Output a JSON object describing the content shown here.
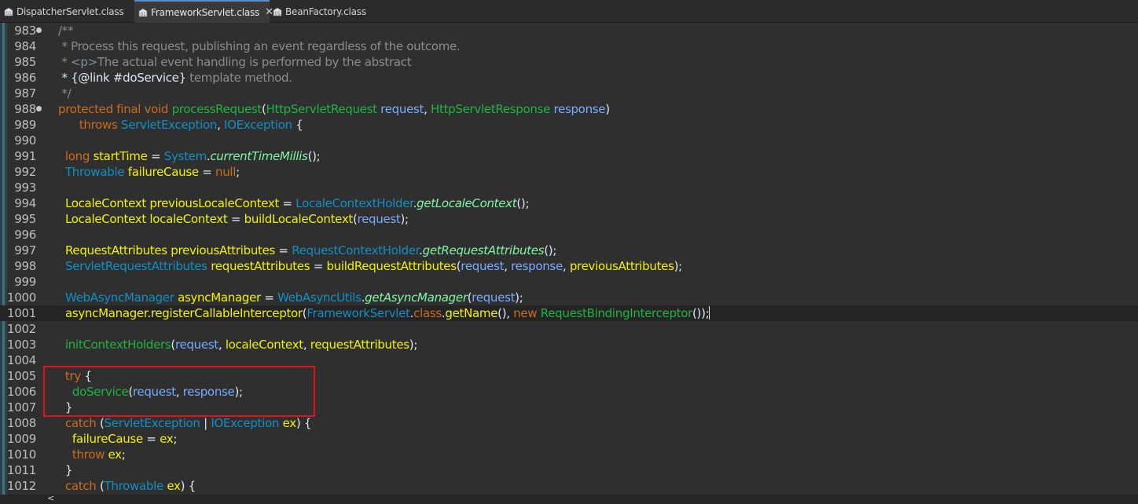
{
  "tabs": [
    {
      "label": "DispatcherServlet.class",
      "active": false,
      "closable": false,
      "icon": "class-file-icon"
    },
    {
      "label": "FrameworkServlet.class",
      "active": true,
      "closable": true,
      "icon": "class-file-icon"
    },
    {
      "label": "BeanFactory.class",
      "active": false,
      "closable": false,
      "icon": "class-file-icon"
    }
  ],
  "close_glyph": "✕",
  "scroll_left_glyph": "<",
  "colors": {
    "background": "#2f2f2f",
    "keyword": "#cc6c1d",
    "type": "#1290c3",
    "method": "#1eb540",
    "static_method": "#80f6a7",
    "parameter": "#79abff",
    "local_variable": "#f2f200",
    "comment": "#8c8c8c",
    "highlight_box": "#e0141e"
  },
  "lines": [
    {
      "n": "983",
      "fold": true,
      "t": [
        {
          "s": "/**",
          "k": "c"
        }
      ]
    },
    {
      "n": "984",
      "t": [
        {
          "s": " * Process this request, publishing an event regardless of the outcome.",
          "k": "c"
        }
      ]
    },
    {
      "n": "985",
      "t": [
        {
          "s": " * ",
          "k": "c"
        },
        {
          "s": "<p>",
          "k": "ct"
        },
        {
          "s": "The actual event handling is performed by the abstract",
          "k": "c"
        }
      ]
    },
    {
      "n": "986",
      "t": [
        {
          "s": " * {@link #doService}",
          "k": "tx"
        },
        {
          "s": " template method.",
          "k": "c"
        }
      ]
    },
    {
      "n": "987",
      "t": [
        {
          "s": " */",
          "k": "c"
        }
      ]
    },
    {
      "n": "988",
      "fold": true,
      "t": [
        {
          "s": "protected final void ",
          "k": "kw"
        },
        {
          "s": "processRequest",
          "k": "fn"
        },
        {
          "s": "(",
          "k": "tx"
        },
        {
          "s": "HttpServletRequest",
          "k": "fn"
        },
        {
          "s": " ",
          "k": "tx"
        },
        {
          "s": "request",
          "k": "pa"
        },
        {
          "s": ", ",
          "k": "tx"
        },
        {
          "s": "HttpServletResponse",
          "k": "fn"
        },
        {
          "s": " ",
          "k": "tx"
        },
        {
          "s": "response",
          "k": "pa"
        },
        {
          "s": ")",
          "k": "tx"
        }
      ]
    },
    {
      "n": "989",
      "t": [
        {
          "s": "      throws ",
          "k": "kw"
        },
        {
          "s": "ServletException",
          "k": "ty"
        },
        {
          "s": ", ",
          "k": "tx"
        },
        {
          "s": "IOException",
          "k": "ty"
        },
        {
          "s": " {",
          "k": "tx"
        }
      ]
    },
    {
      "n": "990",
      "t": []
    },
    {
      "n": "991",
      "t": [
        {
          "s": "  long ",
          "k": "kw"
        },
        {
          "s": "startTime",
          "k": "lv"
        },
        {
          "s": " = ",
          "k": "tx"
        },
        {
          "s": "System",
          "k": "ty"
        },
        {
          "s": ".",
          "k": "tx"
        },
        {
          "s": "currentTimeMillis",
          "k": "sm"
        },
        {
          "s": "();",
          "k": "tx"
        }
      ]
    },
    {
      "n": "992",
      "t": [
        {
          "s": "  ",
          "k": "tx"
        },
        {
          "s": "Throwable",
          "k": "ty"
        },
        {
          "s": " ",
          "k": "tx"
        },
        {
          "s": "failureCause",
          "k": "lv"
        },
        {
          "s": " = ",
          "k": "tx"
        },
        {
          "s": "null",
          "k": "kw"
        },
        {
          "s": ";",
          "k": "tx"
        }
      ]
    },
    {
      "n": "993",
      "t": []
    },
    {
      "n": "994",
      "t": [
        {
          "s": "  ",
          "k": "tx"
        },
        {
          "s": "LocaleContext",
          "k": "lv"
        },
        {
          "s": " ",
          "k": "tx"
        },
        {
          "s": "previousLocaleContext",
          "k": "lv"
        },
        {
          "s": " = ",
          "k": "tx"
        },
        {
          "s": "LocaleContextHolder",
          "k": "ty"
        },
        {
          "s": ".",
          "k": "tx"
        },
        {
          "s": "getLocaleContext",
          "k": "sm"
        },
        {
          "s": "();",
          "k": "tx"
        }
      ]
    },
    {
      "n": "995",
      "t": [
        {
          "s": "  ",
          "k": "tx"
        },
        {
          "s": "LocaleContext",
          "k": "lv"
        },
        {
          "s": " ",
          "k": "tx"
        },
        {
          "s": "localeContext",
          "k": "lv"
        },
        {
          "s": " = ",
          "k": "tx"
        },
        {
          "s": "buildLocaleContext",
          "k": "lv"
        },
        {
          "s": "(",
          "k": "tx"
        },
        {
          "s": "request",
          "k": "pa"
        },
        {
          "s": ");",
          "k": "tx"
        }
      ]
    },
    {
      "n": "996",
      "t": []
    },
    {
      "n": "997",
      "t": [
        {
          "s": "  ",
          "k": "tx"
        },
        {
          "s": "RequestAttributes",
          "k": "lv"
        },
        {
          "s": " ",
          "k": "tx"
        },
        {
          "s": "previousAttributes",
          "k": "lv"
        },
        {
          "s": " = ",
          "k": "tx"
        },
        {
          "s": "RequestContextHolder",
          "k": "ty"
        },
        {
          "s": ".",
          "k": "tx"
        },
        {
          "s": "getRequestAttributes",
          "k": "sm"
        },
        {
          "s": "();",
          "k": "tx"
        }
      ]
    },
    {
      "n": "998",
      "t": [
        {
          "s": "  ",
          "k": "tx"
        },
        {
          "s": "ServletRequestAttributes",
          "k": "ty"
        },
        {
          "s": " ",
          "k": "tx"
        },
        {
          "s": "requestAttributes",
          "k": "lv"
        },
        {
          "s": " = ",
          "k": "tx"
        },
        {
          "s": "buildRequestAttributes",
          "k": "lv"
        },
        {
          "s": "(",
          "k": "tx"
        },
        {
          "s": "request",
          "k": "pa"
        },
        {
          "s": ", ",
          "k": "tx"
        },
        {
          "s": "response",
          "k": "pa"
        },
        {
          "s": ", ",
          "k": "tx"
        },
        {
          "s": "previousAttributes",
          "k": "lv"
        },
        {
          "s": ");",
          "k": "tx"
        }
      ]
    },
    {
      "n": "999",
      "t": []
    },
    {
      "n": "1000",
      "t": [
        {
          "s": "  ",
          "k": "tx"
        },
        {
          "s": "WebAsyncManager",
          "k": "ty"
        },
        {
          "s": " ",
          "k": "tx"
        },
        {
          "s": "asyncManager",
          "k": "lv"
        },
        {
          "s": " = ",
          "k": "tx"
        },
        {
          "s": "WebAsyncUtils",
          "k": "ty"
        },
        {
          "s": ".",
          "k": "tx"
        },
        {
          "s": "getAsyncManager",
          "k": "sm"
        },
        {
          "s": "(",
          "k": "tx"
        },
        {
          "s": "request",
          "k": "pa"
        },
        {
          "s": ");",
          "k": "tx"
        }
      ]
    },
    {
      "n": "1001",
      "current": true,
      "t": [
        {
          "s": "  ",
          "k": "tx"
        },
        {
          "s": "asyncManager",
          "k": "lv"
        },
        {
          "s": ".",
          "k": "tx"
        },
        {
          "s": "registerCallableInterceptor",
          "k": "lv"
        },
        {
          "s": "(",
          "k": "tx"
        },
        {
          "s": "FrameworkServlet",
          "k": "ty"
        },
        {
          "s": ".",
          "k": "tx"
        },
        {
          "s": "class",
          "k": "kw"
        },
        {
          "s": ".",
          "k": "tx"
        },
        {
          "s": "getName",
          "k": "lv"
        },
        {
          "s": "(), ",
          "k": "tx"
        },
        {
          "s": "new ",
          "k": "kw"
        },
        {
          "s": "RequestBindingInterceptor",
          "k": "fn"
        },
        {
          "s": "());",
          "k": "tx"
        }
      ]
    },
    {
      "n": "1002",
      "t": []
    },
    {
      "n": "1003",
      "t": [
        {
          "s": "  ",
          "k": "tx"
        },
        {
          "s": "initContextHolders",
          "k": "fn"
        },
        {
          "s": "(",
          "k": "tx"
        },
        {
          "s": "request",
          "k": "pa"
        },
        {
          "s": ", ",
          "k": "tx"
        },
        {
          "s": "localeContext",
          "k": "lv"
        },
        {
          "s": ", ",
          "k": "tx"
        },
        {
          "s": "requestAttributes",
          "k": "lv"
        },
        {
          "s": ");",
          "k": "tx"
        }
      ]
    },
    {
      "n": "1004",
      "t": []
    },
    {
      "n": "1005",
      "t": [
        {
          "s": "  try ",
          "k": "kw"
        },
        {
          "s": "{",
          "k": "tx"
        }
      ]
    },
    {
      "n": "1006",
      "t": [
        {
          "s": "    ",
          "k": "tx"
        },
        {
          "s": "doService",
          "k": "fn"
        },
        {
          "s": "(",
          "k": "tx"
        },
        {
          "s": "request",
          "k": "pa"
        },
        {
          "s": ", ",
          "k": "tx"
        },
        {
          "s": "response",
          "k": "pa"
        },
        {
          "s": ");",
          "k": "tx"
        }
      ]
    },
    {
      "n": "1007",
      "t": [
        {
          "s": "  }",
          "k": "tx"
        }
      ]
    },
    {
      "n": "1008",
      "t": [
        {
          "s": "  catch ",
          "k": "kw"
        },
        {
          "s": "(",
          "k": "tx"
        },
        {
          "s": "ServletException",
          "k": "ty"
        },
        {
          "s": " | ",
          "k": "tx"
        },
        {
          "s": "IOException",
          "k": "ty"
        },
        {
          "s": " ",
          "k": "tx"
        },
        {
          "s": "ex",
          "k": "lv"
        },
        {
          "s": ") {",
          "k": "tx"
        }
      ]
    },
    {
      "n": "1009",
      "t": [
        {
          "s": "    ",
          "k": "tx"
        },
        {
          "s": "failureCause",
          "k": "lv"
        },
        {
          "s": " = ",
          "k": "tx"
        },
        {
          "s": "ex",
          "k": "lv"
        },
        {
          "s": ";",
          "k": "tx"
        }
      ]
    },
    {
      "n": "1010",
      "t": [
        {
          "s": "    throw ",
          "k": "kw"
        },
        {
          "s": "ex",
          "k": "lv"
        },
        {
          "s": ";",
          "k": "tx"
        }
      ]
    },
    {
      "n": "1011",
      "t": [
        {
          "s": "  }",
          "k": "tx"
        }
      ]
    },
    {
      "n": "1012",
      "t": [
        {
          "s": "  catch ",
          "k": "kw"
        },
        {
          "s": "(",
          "k": "tx"
        },
        {
          "s": "Throwable",
          "k": "ty"
        },
        {
          "s": " ",
          "k": "tx"
        },
        {
          "s": "ex",
          "k": "lv"
        },
        {
          "s": ") {",
          "k": "tx"
        }
      ]
    }
  ]
}
